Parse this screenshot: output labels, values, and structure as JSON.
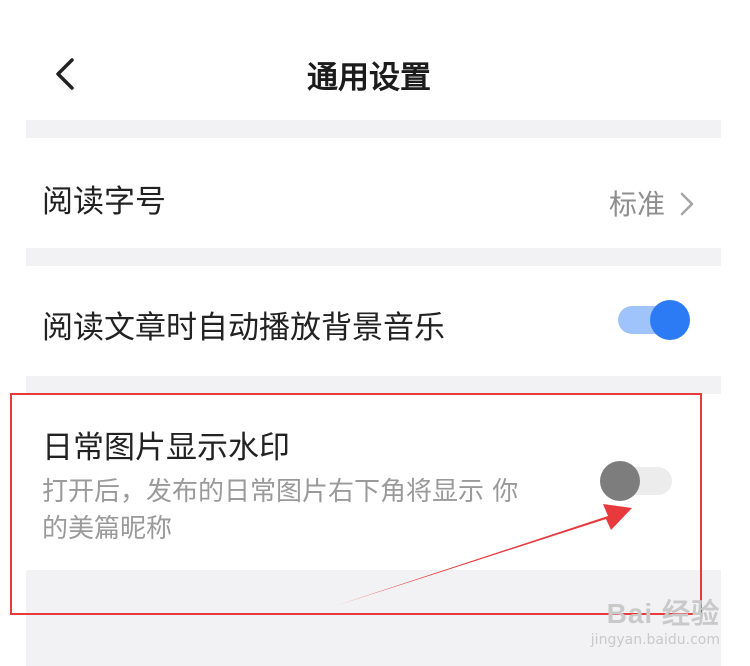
{
  "header": {
    "title": "通用设置"
  },
  "settings": {
    "font_size": {
      "label": "阅读字号",
      "value": "标准"
    },
    "auto_music": {
      "label": "阅读文章时自动播放背景音乐",
      "enabled": true
    },
    "watermark": {
      "label": "日常图片显示水印",
      "description": "打开后，发布的日常图片右下角将显示 你的美篇昵称",
      "enabled": false
    }
  },
  "annotation": {
    "box_color": "#e8393d",
    "arrow_color": "#e8393d"
  },
  "watermark_overlay": {
    "brand": "Bai 经验",
    "url": "jingyan.baidu.com"
  },
  "colors": {
    "accent": "#2d7bf4",
    "background": "#f2f2f4"
  }
}
